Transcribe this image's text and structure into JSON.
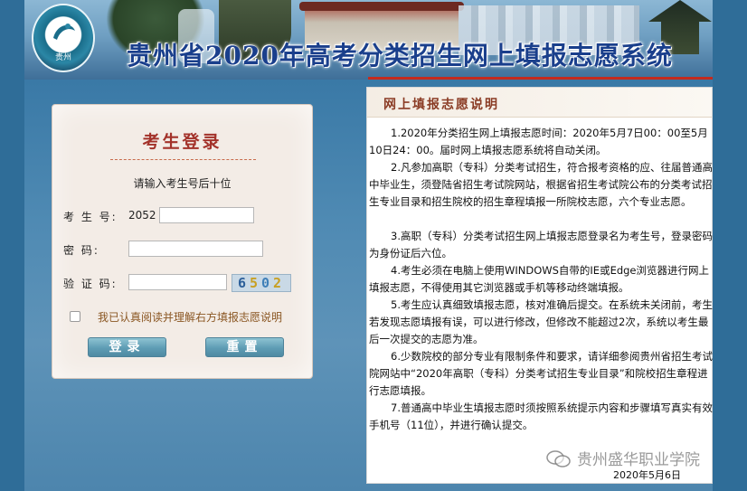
{
  "banner": {
    "title": "贵州省2020年高考分类招生网上填报志愿系统",
    "logo_text": "贵州"
  },
  "login": {
    "title": "考生登录",
    "hint": "请输入考生号后十位",
    "exam_no_label": "考 生 号:",
    "exam_no_prefix": "2052",
    "exam_no_value": "",
    "password_label": "密    码:",
    "password_value": "",
    "captcha_label": "验 证 码:",
    "captcha_value": "",
    "captcha_chars": [
      "6",
      "5",
      "0",
      "2"
    ],
    "agree_label": "我已认真阅读并理解右方填报志愿说明",
    "agree_checked": false,
    "login_button": "登录",
    "reset_button": "重置"
  },
  "instructions": {
    "title": "网上填报志愿说明",
    "items": [
      "1.2020年分类招生网上填报志愿时间：2020年5月7日00：00至5月10日24：00。届时网上填报志愿系统将自动关闭。",
      "2.凡参加高职（专科）分类考试招生，符合报考资格的应、往届普通高中毕业生，须登陆省招生考试院网站，根据省招生考试院公布的分类考试招生专业目录和招生院校的招生章程填报一所院校志愿，六个专业志愿。",
      "3.高职（专科）分类考试招生网上填报志愿登录名为考生号，登录密码为身份证后六位。",
      "4.考生必须在电脑上使用WINDOWS自带的IE或Edge浏览器进行网上填报志愿，不得使用其它浏览器或手机等移动终端填报。",
      "5.考生应认真细致填报志愿，核对准确后提交。在系统未关闭前，考生若发现志愿填报有误，可以进行修改，但修改不能超过2次，系统以考生最后一次提交的志愿为准。",
      "6.少数院校的部分专业有限制条件和要求，请详细参阅贵州省招生考试院网站中“2020年高职（专科）分类考试招生专业目录”和院校招生章程进行志愿填报。",
      "7.普通高中毕业生填报志愿时须按照系统提示内容和步骤填写真实有效手机号（11位），并进行确认提交。"
    ],
    "date": "2020年5月6日"
  },
  "watermark": {
    "text": "贵州盛华职业学院",
    "icon": "wechat-icon"
  }
}
